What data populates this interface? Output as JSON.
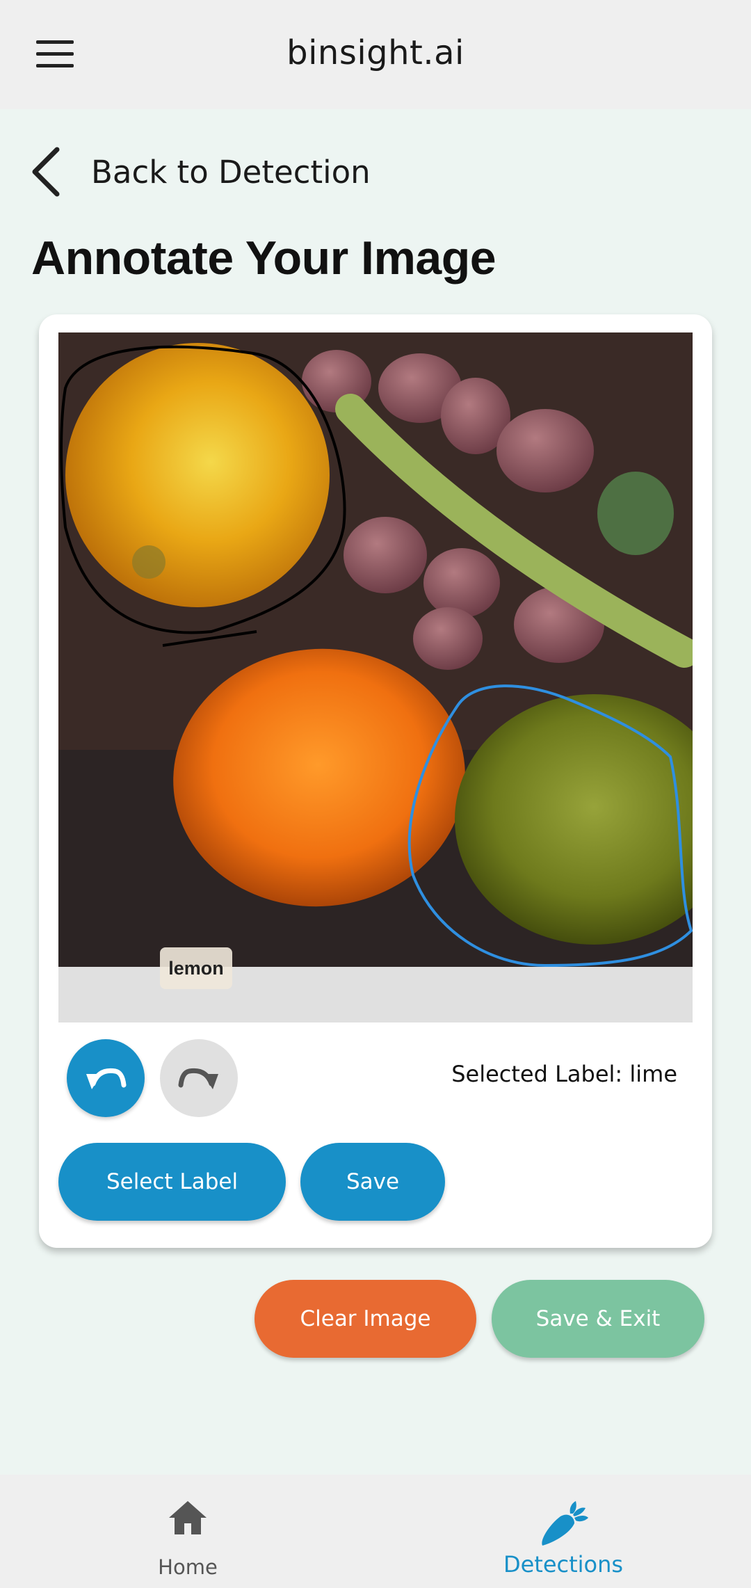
{
  "app_bar": {
    "title": "binsight.ai",
    "menu_icon": "hamburger-menu-icon"
  },
  "navigation": {
    "back_label": "Back to Detection",
    "back_icon": "chevron-left-icon"
  },
  "page": {
    "title": "Annotate Your Image"
  },
  "annotator": {
    "annotations": [
      {
        "label": "lemon",
        "stroke_color": "#000000",
        "tag_visible": true
      },
      {
        "label": "lime",
        "stroke_color": "#2f8fe0",
        "tag_visible": false
      }
    ],
    "undo_icon": "undo-icon",
    "redo_icon": "redo-icon",
    "selected_label_text": "Selected Label: lime",
    "select_label_button": "Select Label",
    "save_button": "Save"
  },
  "actions": {
    "clear_image": "Clear Image",
    "save_and_exit": "Save & Exit"
  },
  "bottom_nav": {
    "items": [
      {
        "label": "Home",
        "icon": "home-icon",
        "active": false
      },
      {
        "label": "Detections",
        "icon": "carrot-icon",
        "active": true
      }
    ]
  },
  "colors": {
    "primary": "#1890c8",
    "danger": "#e86a32",
    "success": "#7cc4a0",
    "background": "#edf5f2"
  }
}
